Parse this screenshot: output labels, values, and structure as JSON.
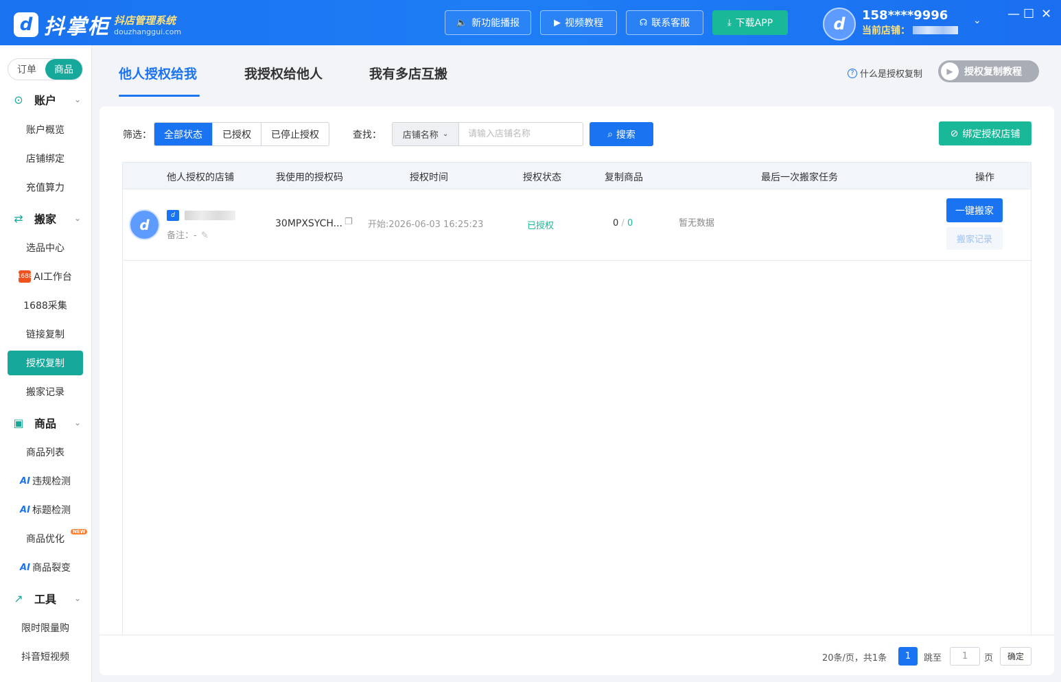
{
  "app": {
    "logo_mark": "d",
    "name": "抖掌柜",
    "subtitle": "抖店管理系统",
    "domain": "douzhanggui.com"
  },
  "top_buttons": [
    {
      "label": "新功能播报",
      "icon": "speaker-icon"
    },
    {
      "label": "视频教程",
      "icon": "video-icon"
    },
    {
      "label": "联系客服",
      "icon": "headset-icon"
    },
    {
      "label": "下载APP",
      "icon": "download-icon"
    }
  ],
  "user": {
    "phone": "158****9996",
    "current_shop_label": "当前店铺："
  },
  "sidebar": {
    "switch": [
      "订单",
      "商品"
    ],
    "sections": [
      {
        "label": "账户",
        "items": [
          "账户概览",
          "店铺绑定",
          "充值算力"
        ]
      },
      {
        "label": "搬家",
        "items": [
          "选品中心",
          "AI工作台",
          "1688采集",
          "链接复制",
          "授权复制",
          "搬家记录"
        ]
      },
      {
        "label": "商品",
        "items": [
          "商品列表",
          "违规检测",
          "标题检测",
          "商品优化",
          "商品裂变"
        ]
      },
      {
        "label": "工具",
        "items": [
          "限时限量购",
          "抖音短视频"
        ]
      }
    ],
    "ai_prefix": "AI",
    "img_badge": "1688",
    "new_badge": "NEW",
    "active_item": "授权复制"
  },
  "tabs": [
    "他人授权给我",
    "我授权给他人",
    "我有多店互搬"
  ],
  "active_tab": "他人授权给我",
  "help_link": "什么是授权复制",
  "tutorial_button": "授权复制教程",
  "filter": {
    "label": "筛选：",
    "options": [
      "全部状态",
      "已授权",
      "已停止授权"
    ],
    "selected": "全部状态"
  },
  "search": {
    "label": "查找：",
    "field": "店铺名称",
    "placeholder": "请输入店铺名称",
    "button": "搜索"
  },
  "bind_button": "绑定授权店铺",
  "table": {
    "columns": [
      "他人授权的店铺",
      "我使用的授权码",
      "授权时间",
      "授权状态",
      "复制商品",
      "最后一次搬家任务",
      "操作"
    ],
    "rows": [
      {
        "shop_note": "备注：-",
        "auth_code": "30MPXSYCH...",
        "auth_time": "开始:2026-06-03 16:25:23",
        "status": "已授权",
        "copied_left": "0",
        "copied_sep": "/",
        "copied_right": "0",
        "last_task": "暂无数据",
        "action_primary": "一键搬家",
        "action_secondary": "搬家记录"
      }
    ]
  },
  "pagination": {
    "summary": "20条/页，共1条",
    "current": "1",
    "jump_label": "跳至",
    "jump_value": "1",
    "unit": "页",
    "confirm": "确定"
  },
  "colors": {
    "brand_blue": "#1a73f0",
    "teal": "#16a89a",
    "green": "#19b899"
  }
}
